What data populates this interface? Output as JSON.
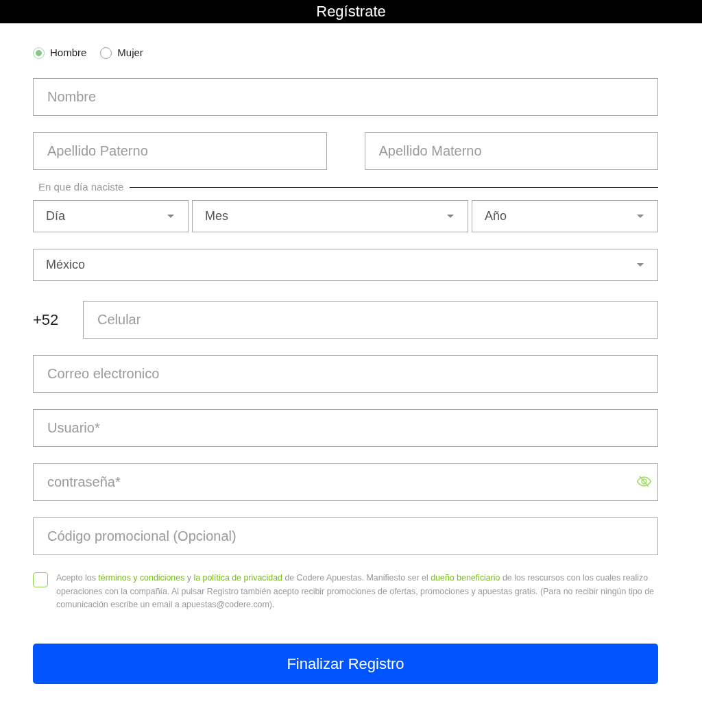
{
  "header": {
    "title": "Regístrate"
  },
  "gender": [
    {
      "label": "Hombre",
      "selected": true
    },
    {
      "label": "Mujer",
      "selected": false
    }
  ],
  "name_field": {
    "placeholder": "Nombre"
  },
  "surname_fields": [
    {
      "placeholder": "Apellido Paterno"
    },
    {
      "placeholder": "Apellido Materno"
    }
  ],
  "birthdate": {
    "label": "En que día naciste",
    "selects": [
      {
        "value": "Día"
      },
      {
        "value": "Mes"
      },
      {
        "value": "Año"
      }
    ]
  },
  "country_select": {
    "value": "México"
  },
  "phone": {
    "prefix": "+52",
    "placeholder": "Celular"
  },
  "fields": [
    {
      "kind": "email",
      "placeholder": "Correo electronico"
    },
    {
      "kind": "text",
      "placeholder": "Usuario*"
    },
    {
      "kind": "password",
      "placeholder": "contraseña*"
    },
    {
      "kind": "text",
      "placeholder": "Código promocional (Opcional)"
    }
  ],
  "consent": {
    "checked": false,
    "parts": [
      {
        "kind": "text",
        "text": "Acepto los "
      },
      {
        "kind": "link",
        "text": "términos y condiciones"
      },
      {
        "kind": "text",
        "text": " y "
      },
      {
        "kind": "link",
        "text": "la política de privacidad"
      },
      {
        "kind": "text",
        "text": " de Codere Apuestas. Manifiesto ser el "
      },
      {
        "kind": "link",
        "text": "dueño beneficiario"
      },
      {
        "kind": "text",
        "text": " de los rescursos con los cuales realizo operaciones con la compañía. Al pulsar Registro también acepto recibir promociones de ofertas, promociones y apuestas gratis. (Para no recibir ningún tipo de comunicación escribe un email a apuestas@codere.com)."
      }
    ]
  },
  "submit": {
    "label": "Finalizar Registro"
  }
}
